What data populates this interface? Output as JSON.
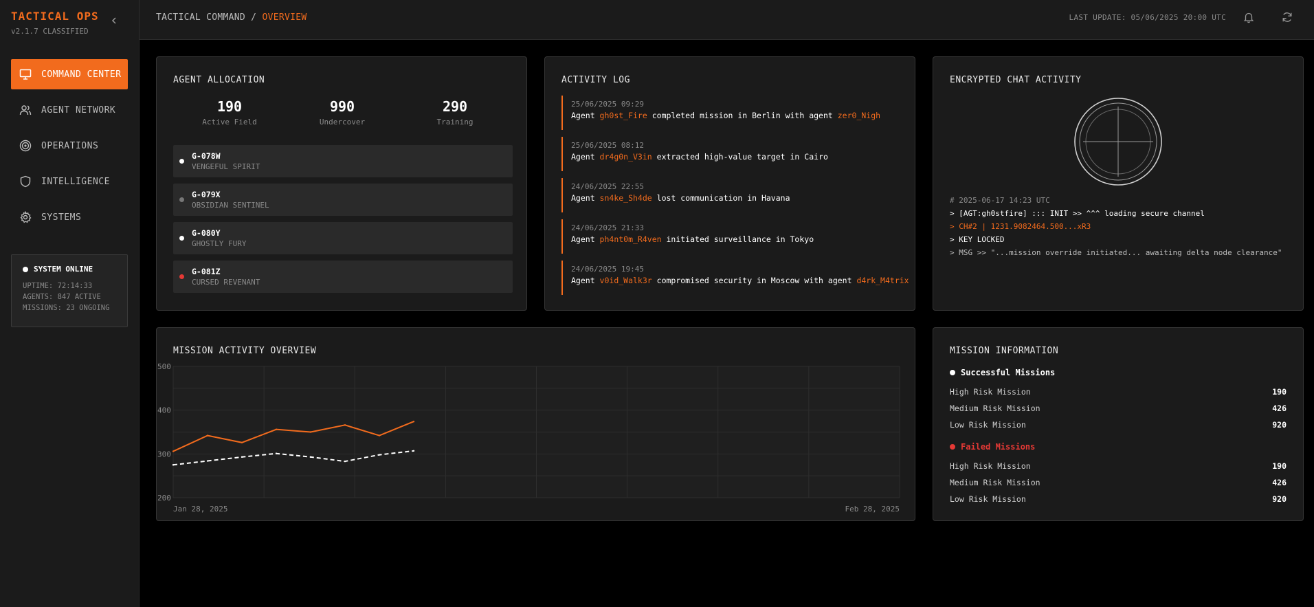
{
  "brand": {
    "title": "TACTICAL OPS",
    "version": "v2.1.7 CLASSIFIED"
  },
  "sidebar": {
    "collapse_icon": "chevron-left-icon",
    "items": [
      {
        "label": "COMMAND CENTER",
        "icon": "monitor-icon",
        "active": true
      },
      {
        "label": "AGENT NETWORK",
        "icon": "users-icon",
        "active": false
      },
      {
        "label": "OPERATIONS",
        "icon": "target-icon",
        "active": false
      },
      {
        "label": "INTELLIGENCE",
        "icon": "shield-icon",
        "active": false
      },
      {
        "label": "SYSTEMS",
        "icon": "gear-icon",
        "active": false
      }
    ],
    "status": {
      "title": "SYSTEM ONLINE",
      "uptime": "UPTIME: 72:14:33",
      "agents": "AGENTS: 847 ACTIVE",
      "missions": "MISSIONS: 23 ONGOING"
    }
  },
  "header": {
    "breadcrumb_root": "TACTICAL COMMAND",
    "breadcrumb_sep": "/",
    "breadcrumb_current": "OVERVIEW",
    "last_update": "LAST UPDATE: 05/06/2025 20:00 UTC",
    "icons": [
      "bell-icon",
      "refresh-icon"
    ]
  },
  "allocation": {
    "title": "AGENT ALLOCATION",
    "stats": [
      {
        "value": "190",
        "label": "Active Field"
      },
      {
        "value": "990",
        "label": "Undercover"
      },
      {
        "value": "290",
        "label": "Training"
      }
    ],
    "agents": [
      {
        "id": "G-078W",
        "name": "VENGEFUL SPIRIT",
        "status_color": "#ffffff"
      },
      {
        "id": "G-079X",
        "name": "OBSIDIAN SENTINEL",
        "status_color": "#777777"
      },
      {
        "id": "G-080Y",
        "name": "GHOSTLY FURY",
        "status_color": "#ffffff"
      },
      {
        "id": "G-081Z",
        "name": "CURSED REVENANT",
        "status_color": "#e53935"
      }
    ]
  },
  "activity": {
    "title": "ACTIVITY LOG",
    "items": [
      {
        "date": "25/06/2025 09:29",
        "p1": "Agent ",
        "a1": "gh0st_Fire",
        "p2": " completed mission in Berlin with agent ",
        "a2": "zer0_Nigh",
        "p3": ""
      },
      {
        "date": "25/06/2025 08:12",
        "p1": "Agent ",
        "a1": "dr4g0n_V3in",
        "p2": " extracted high-value target in Cairo",
        "a2": "",
        "p3": ""
      },
      {
        "date": "24/06/2025 22:55",
        "p1": "Agent ",
        "a1": "sn4ke_Sh4de",
        "p2": " lost communication in Havana",
        "a2": "",
        "p3": ""
      },
      {
        "date": "24/06/2025 21:33",
        "p1": "Agent ",
        "a1": "ph4nt0m_R4ven",
        "p2": " initiated surveillance in Tokyo",
        "a2": "",
        "p3": ""
      },
      {
        "date": "24/06/2025 19:45",
        "p1": "Agent ",
        "a1": "v0id_Walk3r",
        "p2": " compromised security in Moscow with agent ",
        "a2": "d4rk_M4trix",
        "p3": ""
      }
    ]
  },
  "chat": {
    "title": "ENCRYPTED CHAT ACTIVITY",
    "lines": [
      {
        "text": "# 2025-06-17 14:23 UTC",
        "color": "#8a8a8a"
      },
      {
        "text": "> [AGT:gh0stfire] ::: INIT >> ^^^ loading secure channel",
        "color": "#ffffff"
      },
      {
        "text": "> CH#2 | 1231.9082464.500...xR3",
        "color": "#f26b1d"
      },
      {
        "text": "> KEY LOCKED",
        "color": "#ffffff"
      },
      {
        "text": "> MSG >> \"...mission override initiated... awaiting delta node clearance\"",
        "color": "#bdbdbd"
      }
    ]
  },
  "chart_panel": {
    "title": "MISSION ACTIVITY OVERVIEW",
    "start_label": "Jan 28, 2025",
    "end_label": "Feb 28, 2025"
  },
  "chart_data": {
    "type": "line",
    "title": "MISSION ACTIVITY OVERVIEW",
    "ylim": [
      200,
      500
    ],
    "yticks": [
      200,
      300,
      400,
      500
    ],
    "x_range": [
      "Jan 28, 2025",
      "Feb 28, 2025"
    ],
    "grid": true,
    "series": [
      {
        "style": "solid",
        "color": "#f26b1d",
        "values": [
          306,
          342,
          326,
          356,
          350,
          366,
          342,
          374
        ]
      },
      {
        "style": "dashed",
        "color": "#ffffff",
        "values": [
          275,
          284,
          293,
          301,
          293,
          283,
          298,
          307
        ]
      }
    ]
  },
  "mission_info": {
    "title": "MISSION INFORMATION",
    "successful": {
      "title": "Successful Missions",
      "color": "#ffffff",
      "rows": [
        {
          "label": "High Risk Mission",
          "value": "190"
        },
        {
          "label": "Medium Risk Mission",
          "value": "426"
        },
        {
          "label": "Low Risk Mission",
          "value": "920"
        }
      ]
    },
    "failed": {
      "title": "Failed Missions",
      "color": "#e53935",
      "rows": [
        {
          "label": "High Risk Mission",
          "value": "190"
        },
        {
          "label": "Medium Risk Mission",
          "value": "426"
        },
        {
          "label": "Low Risk Mission",
          "value": "920"
        }
      ]
    }
  }
}
